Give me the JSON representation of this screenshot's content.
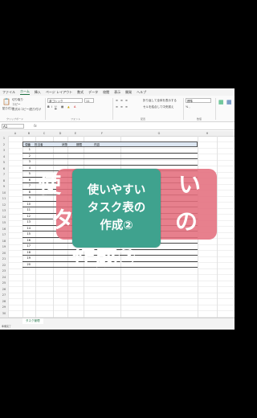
{
  "ribbon": {
    "tabs": [
      "ファイル",
      "ホーム",
      "挿入",
      "ページ レイアウト",
      "数式",
      "データ",
      "校閲",
      "表示",
      "開発",
      "ヘルプ"
    ],
    "active_tab": "ホーム",
    "clipboard": {
      "cut": "切り取り",
      "copy": "コピー",
      "format_painter": "書式のコピー/貼り付け",
      "paste": "貼り付け",
      "group": "クリップボード"
    },
    "font": {
      "name": "游ゴシック",
      "size": "11",
      "group": "フォント"
    },
    "alignment": {
      "wrap": "折り返して全体を表示する",
      "merge": "セルを結合して中央揃え",
      "group": "配置"
    },
    "number": {
      "format": "標準",
      "group": "数値"
    }
  },
  "formula_bar": {
    "name_box": "A1",
    "fx": "fx"
  },
  "grid": {
    "columns": [
      "A",
      "B",
      "C",
      "D",
      "E",
      "F",
      "G",
      "H"
    ],
    "rows": [
      "1",
      "2",
      "3",
      "4",
      "5",
      "6",
      "7",
      "8",
      "9",
      "10",
      "11",
      "12",
      "13",
      "14",
      "15",
      "16",
      "17",
      "18",
      "19",
      "20",
      "21",
      "22",
      "23",
      "24",
      "25",
      "26",
      "27",
      "28",
      "29",
      "30"
    ]
  },
  "table": {
    "headers": [
      "項番",
      "担当者",
      "状態",
      "期限",
      "内容"
    ],
    "numbers": [
      "1",
      "2",
      "3",
      "4",
      "5",
      "6",
      "7",
      "8",
      "9",
      "10",
      "11",
      "12",
      "13",
      "14",
      "15",
      "16",
      "17",
      "18",
      "19",
      "20"
    ]
  },
  "sheet_tab": "タスク管理",
  "status_bar": "準備完了",
  "overlay": {
    "badge_lines": [
      "使いやすい",
      "タスク表の",
      "作成②"
    ],
    "banner_top_left": "使",
    "banner_top_right": "い",
    "banner_mid_left": "タ",
    "banner_mid_right": "の",
    "banner_bottom": "作成②"
  }
}
